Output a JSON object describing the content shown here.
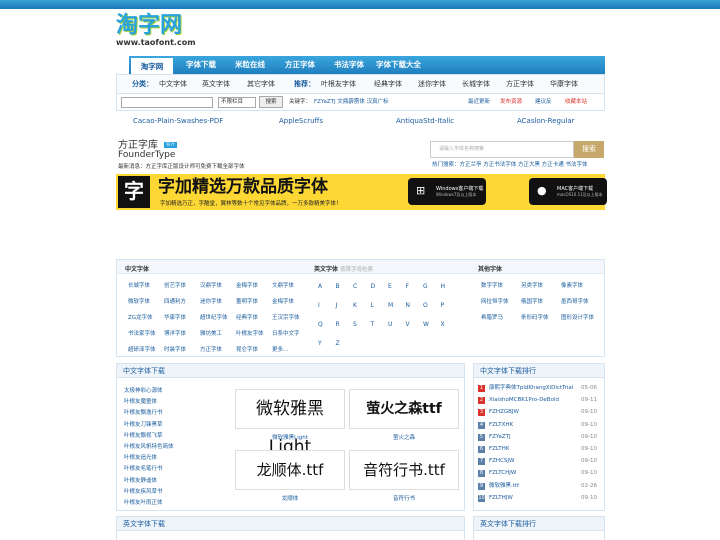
{
  "logo": {
    "main": "淘字网",
    "url": "www.taofont.com"
  },
  "nav": [
    "淘字网",
    "字体下载",
    "米粒在线",
    "方正字体",
    "书法字体",
    "字体下载大全"
  ],
  "cat": {
    "label": "分类：",
    "items": [
      "中文字体",
      "英文字体",
      "其它字体"
    ],
    "rec_label": "推荐：",
    "rec": [
      "叶根友字体",
      "经典字体",
      "迷你字体",
      "长城字体",
      "方正字体",
      "华康字体"
    ]
  },
  "search": {
    "select": "不限栏目",
    "btn": "搜索",
    "kw_label": "关键字：",
    "kw": "FZYaZTJ 文鼎霹雳体 汉真广标",
    "links": [
      "最近更新",
      "发布资源",
      "建议反",
      "收藏本站"
    ]
  },
  "fontlinks": [
    "Cacao-Plain-Swashes-PDF",
    "AppleScruffs",
    "AntiquaStd-Italic",
    "ACaslon-Regular"
  ],
  "founder": {
    "brand": "方正字库",
    "brand2": "FounderType",
    "tag": "官方",
    "news": "最新消息：方正字库正版设计师可免费下载全部字体",
    "search_ph": "请输入字体名称搜索",
    "search_btn": "搜索",
    "hot": "热门搜索：方正兰亭  方正书法字体  方正大黑  方正卡通  书法字体"
  },
  "banner": {
    "icon": "字+",
    "big": "字加精选万款品质字体",
    "small": "字加精选万正，字酷堂，翼林等数十个常见字体品牌，一万多款精美字体！",
    "win1": "Windows客户端下载",
    "win2": "Windows7及以上版本",
    "mac1": "MAC客户端下载",
    "mac2": "macOS10.11及以上版本"
  },
  "directory": {
    "cn_title": "中文字体",
    "cn": [
      "长城字体",
      "创艺字体",
      "汉鼎字体",
      "金梅字体",
      "文鼎字体",
      "微软字体",
      "四通利方",
      "迷你字体",
      "董明字体",
      "金梅字体",
      "ZG龙字体",
      "华康字体",
      "超世纪字体",
      "经典字体",
      "王汉宗字体",
      "书法家字体",
      "博洋字体",
      "雅坊美工",
      "叶根友字体",
      "日系中文字",
      "超研泽字体",
      "时装字体",
      "方正字体",
      "昆仑字体",
      "更多..."
    ],
    "en_title": "英文字体",
    "en_sub": "按首字母检索",
    "letters": [
      "A",
      "B",
      "C",
      "D",
      "E",
      "F",
      "G",
      "H",
      "I",
      "J",
      "K",
      "L",
      "M",
      "N",
      "O",
      "P",
      "Q",
      "R",
      "S",
      "T",
      "U",
      "V",
      "W",
      "X",
      "Y",
      "Z"
    ],
    "other_title": "其他字体",
    "other": [
      "数字字体",
      "另类字体",
      "像素字体",
      "网拉恒字体",
      "俄国字体",
      "墨西哥字体",
      "希腊罗马",
      "条形码字体",
      "图形设计字体"
    ]
  },
  "cn_dl": {
    "title": "中文字体下载",
    "list": [
      "太极神彩心源体",
      "叶根友魔童体",
      "叶根友飘逸行书",
      "叶根友刀锋黑草",
      "叶根友飘视飞草",
      "叶根友风帆特色简体",
      "叶根友追光体",
      "叶根友毛笔行书",
      "叶根友静谧体",
      "叶根友疾风草书",
      "叶根友叶雨正体"
    ],
    "thumbs": [
      {
        "art": "微软雅黑Light",
        "cap": "微软雅黑Light"
      },
      {
        "art": "萤火之森ttf",
        "cap": "萤火之森"
      },
      {
        "art": "龙顺体.ttf",
        "cap": "龙顺体"
      },
      {
        "art": "音符行书.ttf",
        "cap": "音符行书"
      }
    ]
  },
  "rank": {
    "title": "中文字体下载排行",
    "items": [
      {
        "n": "1",
        "name": "康熙字典体TpldKhangXiDictTrial",
        "date": "05-06"
      },
      {
        "n": "2",
        "name": "XiaishoMCBK1Pro-DeBold",
        "date": "09-11"
      },
      {
        "n": "3",
        "name": "FZHZGBJW",
        "date": "09-10"
      },
      {
        "n": "4",
        "name": "FZLTXHK",
        "date": "09-10"
      },
      {
        "n": "5",
        "name": "FZYaZTJ",
        "date": "09-10"
      },
      {
        "n": "6",
        "name": "FZLTHK",
        "date": "09-10"
      },
      {
        "n": "7",
        "name": "FZHCSJW",
        "date": "09-10"
      },
      {
        "n": "8",
        "name": "FZLTCHJW",
        "date": "09-10"
      },
      {
        "n": "9",
        "name": "微软雅黑.ttf",
        "date": "02-26"
      },
      {
        "n": "10",
        "name": "FZLTHJW",
        "date": "09-10"
      }
    ]
  },
  "en_dl": {
    "title": "英文字体下载"
  },
  "en_rank": {
    "title": "英文字体下载排行"
  },
  "colors": {
    "primary": "#2aa3dd",
    "link": "#1a5c9e",
    "banner": "#fdd835",
    "rank_top": "#d9332b",
    "rank_other": "#5a7fa8"
  }
}
